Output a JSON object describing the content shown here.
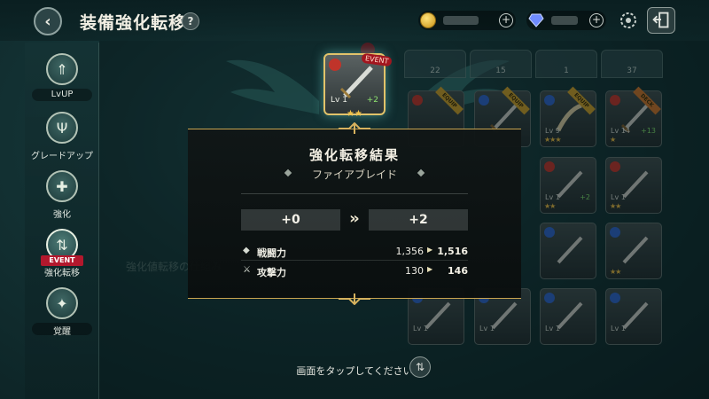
{
  "header": {
    "title": "装備強化転移",
    "help_label": "?",
    "back_icon": "chevron-left-icon"
  },
  "currency": {
    "gold_plus": "+",
    "gem_plus": "+"
  },
  "sidebar": {
    "items": [
      {
        "label": "LvUP"
      },
      {
        "label": "グレードアップ"
      },
      {
        "label": "強化"
      },
      {
        "label": "強化転移",
        "badge": "EVENT"
      },
      {
        "label": "覚醒"
      }
    ]
  },
  "inventory": {
    "tab_counts": [
      "22",
      "15",
      "1",
      "37"
    ],
    "ribbon_equip": "EQUIP",
    "ribbon_deck": "DECK",
    "lv1": "Lv 1",
    "lv9": "Lv 9",
    "lv14": "Lv 14",
    "plus13": "+13",
    "plus2": "+2"
  },
  "featured_item": {
    "level": "Lv 1",
    "plus": "+2",
    "event_tag": "EVENT"
  },
  "background_text": "強化値転移の仕組み",
  "result": {
    "title": "強化転移結果",
    "item_name": "ファイアブレイド",
    "from_level": "+0",
    "to_level": "+2",
    "arrow": "»",
    "stats": [
      {
        "name": "戦闘力",
        "old": "1,356",
        "new": "1,516"
      },
      {
        "name": "攻撃力",
        "old": "130",
        "new": "146"
      }
    ]
  },
  "footer": {
    "tap_text": "画面をタップしてください",
    "sort_icon": "sort-icon"
  },
  "colors": {
    "accent_gold": "#c8a450",
    "event_red": "#b3182d",
    "plus_green": "#8de26f"
  }
}
